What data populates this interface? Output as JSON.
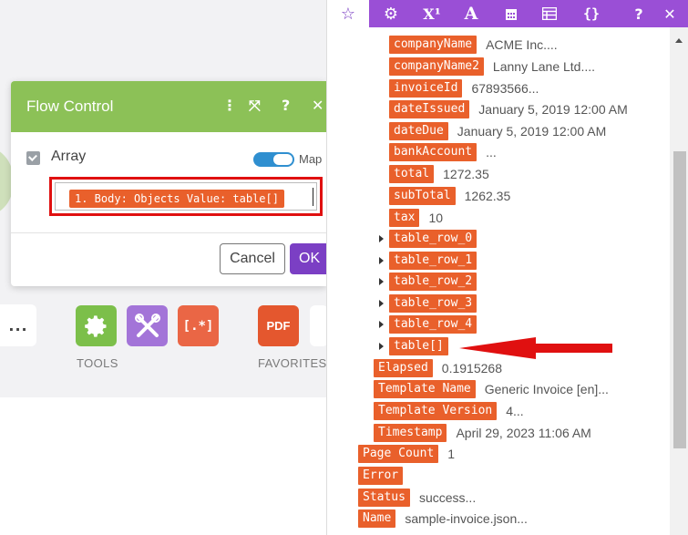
{
  "dialog": {
    "title": "Flow Control",
    "field_label": "Array",
    "map_label": "Map",
    "field_value": "1. Body: Objects Value: table[]",
    "cancel_label": "Cancel",
    "ok_label": "OK"
  },
  "toolbar": {
    "more_label": "...",
    "bracket_label": "[.*]",
    "pdf_label": "PDF",
    "tools_label": "TOOLS",
    "favorites_label": "FAVORITES"
  },
  "panel": {
    "tabs": [
      {
        "icon": "star-icon",
        "label": "☆"
      },
      {
        "icon": "gear-icon",
        "label": "⚙"
      },
      {
        "icon": "superscript-icon",
        "label": "X¹"
      },
      {
        "icon": "text-icon",
        "label": "A"
      },
      {
        "icon": "calendar-icon",
        "label": ""
      },
      {
        "icon": "table-icon",
        "label": ""
      },
      {
        "icon": "braces-icon",
        "label": "{}"
      },
      {
        "icon": "help-icon",
        "label": "?"
      },
      {
        "icon": "close-icon",
        "label": "✕"
      }
    ],
    "rows": [
      {
        "key": "companyName",
        "value": "ACME Inc...."
      },
      {
        "key": "companyName2",
        "value": "Lanny Lane Ltd...."
      },
      {
        "key": "invoiceId",
        "value": "67893566..."
      },
      {
        "key": "dateIssued",
        "value": "January 5, 2019 12:00 AM"
      },
      {
        "key": "dateDue",
        "value": "January 5, 2019 12:00 AM"
      },
      {
        "key": "bankAccount",
        "value": "..."
      },
      {
        "key": "total",
        "value": "1272.35"
      },
      {
        "key": "subTotal",
        "value": "1262.35"
      },
      {
        "key": "tax",
        "value": "10"
      },
      {
        "key": "table_row_0",
        "value": ""
      },
      {
        "key": "table_row_1",
        "value": ""
      },
      {
        "key": "table_row_2",
        "value": ""
      },
      {
        "key": "table_row_3",
        "value": ""
      },
      {
        "key": "table_row_4",
        "value": ""
      },
      {
        "key": "table[]",
        "value": ""
      },
      {
        "key": "Elapsed",
        "value": "0.1915268"
      },
      {
        "key": "Template Name",
        "value": "Generic Invoice [en]..."
      },
      {
        "key": "Template Version",
        "value": "4..."
      },
      {
        "key": "Timestamp",
        "value": "April 29, 2023 11:06 AM"
      },
      {
        "key": "Page Count",
        "value": "1"
      },
      {
        "key": "Error",
        "value": ""
      },
      {
        "key": "Status",
        "value": "success..."
      },
      {
        "key": "Name",
        "value": "sample-invoice.json..."
      }
    ]
  },
  "colors": {
    "accent_purple": "#9a4fd6",
    "pill_orange": "#e9602b",
    "header_green": "#8cc157",
    "highlight_red": "#e01010"
  }
}
